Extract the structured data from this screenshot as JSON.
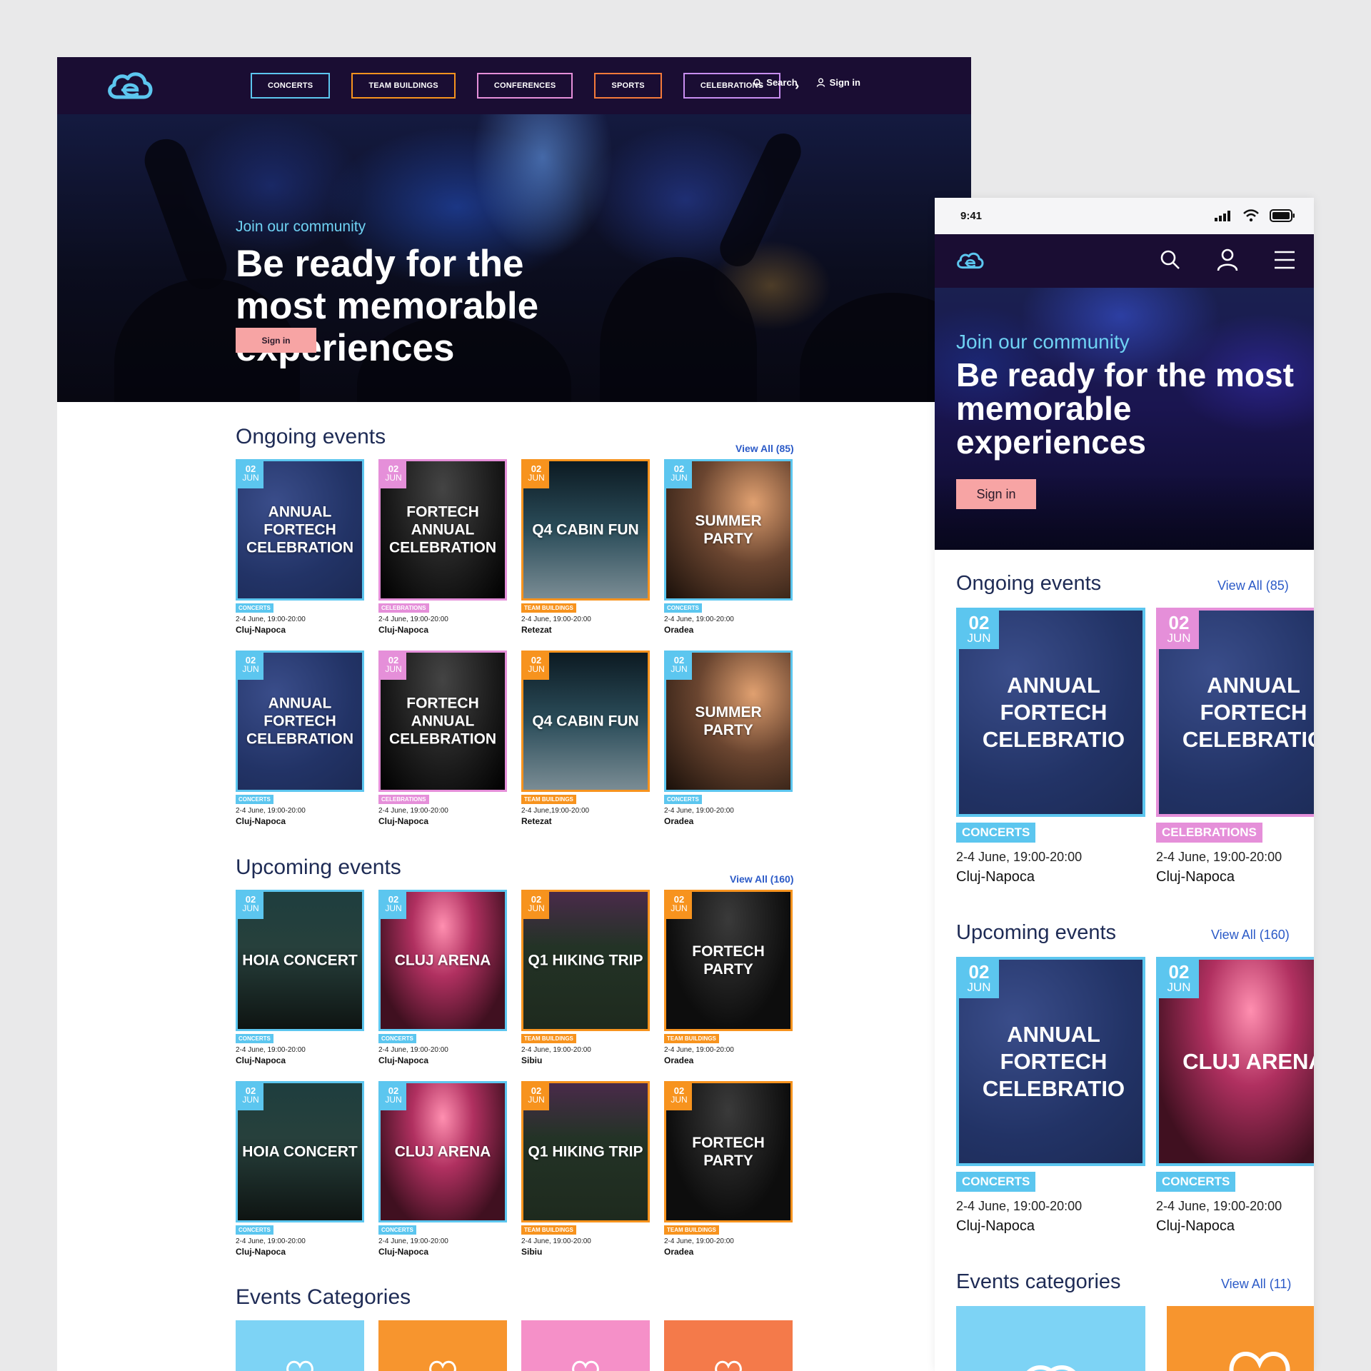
{
  "colors": {
    "nav_bg": "#1a0d33",
    "concerts": "#5cc6ef",
    "team_buildings": "#f7931e",
    "conferences": "#e58fd9",
    "sports": "#f47a3a",
    "celebrations": "#c88ef0",
    "accent_button": "#f7a4a4",
    "link": "#2b5ac7"
  },
  "desktop": {
    "nav": {
      "buttons": [
        "CONCERTS",
        "TEAM BUILDINGS",
        "CONFERENCES",
        "SPORTS",
        "CELEBRATIONS"
      ],
      "search": "Search",
      "signin": "Sign in"
    },
    "hero": {
      "subtitle": "Join our community",
      "title": "Be ready for the most memorable experiences",
      "button": "Sign in"
    },
    "ongoing": {
      "title": "Ongoing events",
      "view_all": "View All (85)",
      "cards": [
        {
          "day": "02",
          "month": "JUN",
          "title": "ANNUAL FORTECH CELEBRATION",
          "tag": "CONCERTS",
          "time": "2-4 June, 19:00-20:00",
          "location": "Cluj-Napoca"
        },
        {
          "day": "02",
          "month": "JUN",
          "title": "FORTECH ANNUAL CELEBRATION",
          "tag": "CELEBRATIONS",
          "time": "2-4 June, 19:00-20:00",
          "location": "Cluj-Napoca"
        },
        {
          "day": "02",
          "month": "JUN",
          "title": "Q4 CABIN FUN",
          "tag": "TEAM BUILDINGS",
          "time": "2-4 June, 19:00-20:00",
          "location": "Retezat"
        },
        {
          "day": "02",
          "month": "JUN",
          "title": "SUMMER PARTY",
          "tag": "CONCERTS",
          "time": "2-4 June, 19:00-20:00",
          "location": "Oradea"
        },
        {
          "day": "02",
          "month": "JUN",
          "title": "ANNUAL FORTECH CELEBRATION",
          "tag": "CONCERTS",
          "time": "2-4 June, 19:00-20:00",
          "location": "Cluj-Napoca"
        },
        {
          "day": "02",
          "month": "JUN",
          "title": "FORTECH ANNUAL CELEBRATION",
          "tag": "CELEBRATIONS",
          "time": "2-4 June, 19:00-20:00",
          "location": "Cluj-Napoca"
        },
        {
          "day": "02",
          "month": "JUN",
          "title": "Q4 CABIN FUN",
          "tag": "TEAM BUILDINGS",
          "time": "2-4 June,19:00-20:00",
          "location": "Retezat"
        },
        {
          "day": "02",
          "month": "JUN",
          "title": "SUMMER PARTY",
          "tag": "CONCERTS",
          "time": "2-4 June, 19:00-20:00",
          "location": "Oradea"
        }
      ]
    },
    "upcoming": {
      "title": "Upcoming events",
      "view_all": "View All (160)",
      "cards": [
        {
          "day": "02",
          "month": "JUN",
          "title": "HOIA CONCERT",
          "tag": "CONCERTS",
          "time": "2-4 June, 19:00-20:00",
          "location": "Cluj-Napoca"
        },
        {
          "day": "02",
          "month": "JUN",
          "title": "CLUJ ARENA",
          "tag": "CONCERTS",
          "time": "2-4 June, 19:00-20:00",
          "location": "Cluj-Napoca"
        },
        {
          "day": "02",
          "month": "JUN",
          "title": "Q1 HIKING TRIP",
          "tag": "TEAM BUILDINGS",
          "time": "2-4 June, 19:00-20:00",
          "location": "Sibiu"
        },
        {
          "day": "02",
          "month": "JUN",
          "title": "FORTECH PARTY",
          "tag": "TEAM BUILDINGS",
          "time": "2-4 June, 19:00-20:00",
          "location": "Oradea"
        },
        {
          "day": "02",
          "month": "JUN",
          "title": "HOIA CONCERT",
          "tag": "CONCERTS",
          "time": "2-4 June, 19:00-20:00",
          "location": "Cluj-Napoca"
        },
        {
          "day": "02",
          "month": "JUN",
          "title": "CLUJ ARENA",
          "tag": "CONCERTS",
          "time": "2-4 June, 19:00-20:00",
          "location": "Cluj-Napoca"
        },
        {
          "day": "02",
          "month": "JUN",
          "title": "Q1 HIKING TRIP",
          "tag": "TEAM BUILDINGS",
          "time": "2-4 June, 19:00-20:00",
          "location": "Sibiu"
        },
        {
          "day": "02",
          "month": "JUN",
          "title": "FORTECH PARTY",
          "tag": "TEAM BUILDINGS",
          "time": "2-4 June, 19:00-20:00",
          "location": "Oradea"
        }
      ]
    },
    "categories": {
      "title": "Events Categories",
      "colors": [
        "#7dd3f5",
        "#f7952e",
        "#f590c8",
        "#f47a4a"
      ]
    }
  },
  "mobile": {
    "status": {
      "time": "9:41"
    },
    "hero": {
      "subtitle": "Join our community",
      "title": "Be ready for the most memorable experiences",
      "button": "Sign in"
    },
    "ongoing": {
      "title": "Ongoing events",
      "view_all": "View All (85)",
      "cards": [
        {
          "day": "02",
          "month": "JUN",
          "title": "ANNUAL\nFORTECH\nCELEBRATIO",
          "tag": "CONCERTS",
          "time": "2-4 June, 19:00-20:00",
          "location": "Cluj-Napoca"
        },
        {
          "day": "02",
          "month": "JUN",
          "title": "ANNUAL\nFORTECH\nCELEBRATIO",
          "tag": "CELEBRATIONS",
          "time": "2-4 June, 19:00-20:00",
          "location": "Cluj-Napoca"
        }
      ]
    },
    "upcoming": {
      "title": "Upcoming events",
      "view_all": "View All (160)",
      "cards": [
        {
          "day": "02",
          "month": "JUN",
          "title": "ANNUAL\nFORTECH\nCELEBRATIO",
          "tag": "CONCERTS",
          "time": "2-4 June, 19:00-20:00",
          "location": "Cluj-Napoca"
        },
        {
          "day": "02",
          "month": "JUN",
          "title": "CLUJ ARENA",
          "tag": "CONCERTS",
          "time": "2-4 June, 19:00-20:00",
          "location": "Cluj-Napoca"
        }
      ]
    },
    "categories": {
      "title": "Events categories",
      "view_all": "View All (11)"
    }
  }
}
